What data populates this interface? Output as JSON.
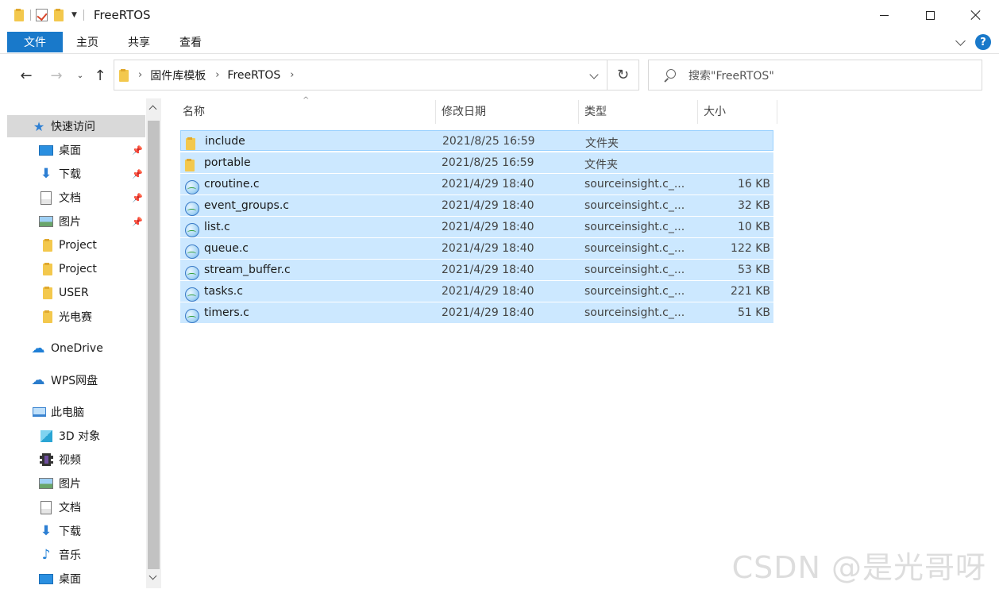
{
  "window": {
    "title": "FreeRTOS",
    "minimize_icon": "minimize-icon",
    "maximize_icon": "maximize-icon",
    "close_icon": "close-icon"
  },
  "ribbon": {
    "tabs": [
      {
        "label": "文件",
        "active": true
      },
      {
        "label": "主页"
      },
      {
        "label": "共享"
      },
      {
        "label": "查看"
      }
    ],
    "help_label": "?"
  },
  "address": {
    "crumbs": [
      "固件库模板",
      "FreeRTOS"
    ],
    "search_placeholder": "搜索\"FreeRTOS\""
  },
  "nav_pane": {
    "items": [
      {
        "label": "快速访问",
        "icon": "star-icon",
        "active": true,
        "pinned": false
      },
      {
        "label": "桌面",
        "icon": "desktop-icon",
        "pinned": true
      },
      {
        "label": "下载",
        "icon": "download-icon",
        "pinned": true
      },
      {
        "label": "文档",
        "icon": "document-icon",
        "pinned": true
      },
      {
        "label": "图片",
        "icon": "picture-icon",
        "pinned": true
      },
      {
        "label": "Project",
        "icon": "folder-icon",
        "pinned": false
      },
      {
        "label": "Project",
        "icon": "folder-icon",
        "pinned": false
      },
      {
        "label": "USER",
        "icon": "folder-icon",
        "pinned": false
      },
      {
        "label": "光电赛",
        "icon": "folder-icon",
        "pinned": false
      },
      {
        "label": "OneDrive",
        "icon": "cloud-icon",
        "pinned": false
      },
      {
        "label": "WPS网盘",
        "icon": "cloud-icon",
        "pinned": false
      },
      {
        "label": "此电脑",
        "icon": "computer-icon",
        "pinned": false
      },
      {
        "label": "3D 对象",
        "icon": "cube-icon",
        "pinned": false
      },
      {
        "label": "视频",
        "icon": "video-icon",
        "pinned": false
      },
      {
        "label": "图片",
        "icon": "picture-icon",
        "pinned": false
      },
      {
        "label": "文档",
        "icon": "document-icon",
        "pinned": false
      },
      {
        "label": "下载",
        "icon": "download-icon",
        "pinned": false
      },
      {
        "label": "音乐",
        "icon": "music-icon",
        "pinned": false
      },
      {
        "label": "桌面",
        "icon": "desktop-icon",
        "pinned": false
      }
    ]
  },
  "file_list": {
    "columns": [
      "名称",
      "修改日期",
      "类型",
      "大小"
    ],
    "rows": [
      {
        "name": "include",
        "date": "2021/8/25 16:59",
        "type": "文件夹",
        "size": "",
        "icon": "folder-icon"
      },
      {
        "name": "portable",
        "date": "2021/8/25 16:59",
        "type": "文件夹",
        "size": "",
        "icon": "folder-icon"
      },
      {
        "name": "croutine.c",
        "date": "2021/4/29 18:40",
        "type": "sourceinsight.c_...",
        "size": "16 KB",
        "icon": "source-file-icon"
      },
      {
        "name": "event_groups.c",
        "date": "2021/4/29 18:40",
        "type": "sourceinsight.c_...",
        "size": "32 KB",
        "icon": "source-file-icon"
      },
      {
        "name": "list.c",
        "date": "2021/4/29 18:40",
        "type": "sourceinsight.c_...",
        "size": "10 KB",
        "icon": "source-file-icon"
      },
      {
        "name": "queue.c",
        "date": "2021/4/29 18:40",
        "type": "sourceinsight.c_...",
        "size": "122 KB",
        "icon": "source-file-icon"
      },
      {
        "name": "stream_buffer.c",
        "date": "2021/4/29 18:40",
        "type": "sourceinsight.c_...",
        "size": "53 KB",
        "icon": "source-file-icon"
      },
      {
        "name": "tasks.c",
        "date": "2021/4/29 18:40",
        "type": "sourceinsight.c_...",
        "size": "221 KB",
        "icon": "source-file-icon"
      },
      {
        "name": "timers.c",
        "date": "2021/4/29 18:40",
        "type": "sourceinsight.c_...",
        "size": "51 KB",
        "icon": "source-file-icon"
      }
    ]
  },
  "watermark": "CSDN @是光哥呀",
  "colors": {
    "accent": "#1979ca",
    "selection": "#cce8ff",
    "selection_border": "#99d1ff",
    "folder": "#f3c84d"
  }
}
